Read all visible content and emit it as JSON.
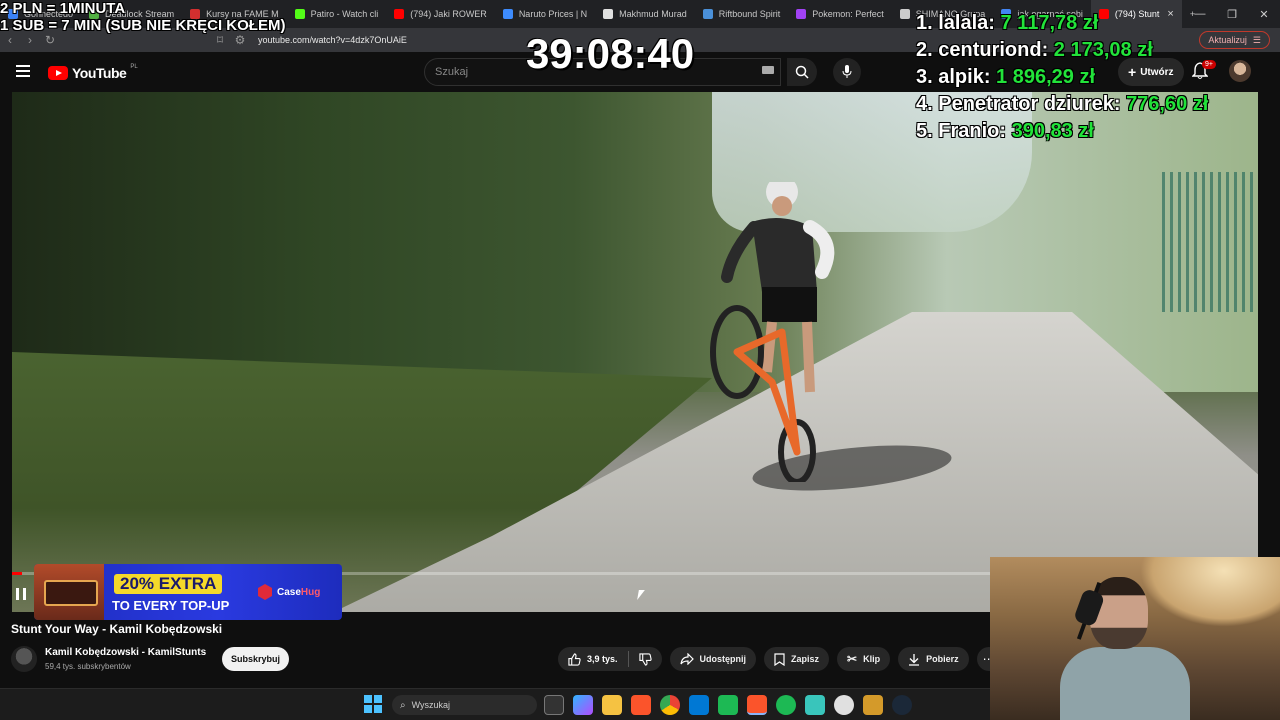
{
  "browser": {
    "tabs": [
      {
        "label": "Gonnectedo",
        "color": "#3b82f6"
      },
      {
        "label": "Deadlock Stream",
        "color": "#52b043"
      },
      {
        "label": "Kursy na FAME M",
        "color": "#d32f2f"
      },
      {
        "label": "Patiro - Watch cli",
        "color": "#53fc18"
      },
      {
        "label": "(794) Jaki ROWER",
        "color": "#ff0000"
      },
      {
        "label": "Naruto Prices | N",
        "color": "#3d8bfd"
      },
      {
        "label": "Makhmud Murad",
        "color": "#e0e0e0"
      },
      {
        "label": "Riftbound Spirit",
        "color": "#4a90d9"
      },
      {
        "label": "Pokemon: Perfect",
        "color": "#a142f4"
      },
      {
        "label": "SHIMANO Grupa",
        "color": "#cccccc"
      },
      {
        "label": "jak ogarnąć sobi",
        "color": "#4285f4"
      },
      {
        "label": "(794) Stunt",
        "color": "#ff0000"
      }
    ],
    "new_tab": "+",
    "window_controls": [
      "—",
      "❐",
      "✕"
    ],
    "url": "youtube.com/watch?v=4dzk7OnUAiE",
    "update_button": "Aktualizuj"
  },
  "overlay": {
    "rate_lines": [
      "2 PLN = 1MINUTA",
      "1 SUB = 7 MIN (SUB NIE KRĘCI KOŁEM)"
    ],
    "timer": "39:08:40",
    "leaderboard": [
      {
        "name": "1. lalala: ",
        "amount": "7 117,78 zł"
      },
      {
        "name": "2. centuriond: ",
        "amount": "2 173,08 zł"
      },
      {
        "name": "3. alpik: ",
        "amount": "1 896,29 zł"
      },
      {
        "name": "4. Penetrator dziurek: ",
        "amount": "776,60 zł"
      },
      {
        "name": "5. Franio: ",
        "amount": "390,83 zł"
      }
    ]
  },
  "youtube": {
    "logo": "YouTube",
    "country": "PL",
    "search_placeholder": "Szukaj",
    "create_label": "Utwórz",
    "notifications_badge": "9+",
    "video": {
      "progress": 0.01,
      "title": "Stunt Your Way - Kamil Kobędzowski",
      "channel": "Kamil Kobędzowski - KamilStunts",
      "subscribers": "59,4 tys. subskrybentów",
      "subscribe_label": "Subskrybuj",
      "likes": "3,9 tys.",
      "share_label": "Udostępnij",
      "save_label": "Zapisz",
      "clip_label": "Klip",
      "download_label": "Pobierz"
    },
    "ad": {
      "top_text": "20% EXTRA",
      "bottom_text": "TO EVERY TOP-UP",
      "brand_case": "Case",
      "brand_hug": "Hug"
    }
  },
  "taskbar": {
    "search_placeholder": "Wyszukaj"
  }
}
